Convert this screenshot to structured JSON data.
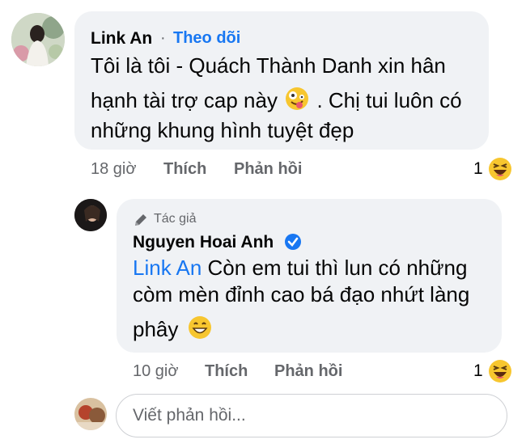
{
  "comment": {
    "author": "Link An",
    "separator": "·",
    "follow_label": "Theo dõi",
    "line1": "Tôi là tôi - Quách Thành Danh xin hân",
    "line2a": "hạnh tài trợ cap này",
    "line2b": ". Chị tui luôn có",
    "line3": "những khung hình tuyệt đẹp",
    "time": "18 giờ",
    "like_label": "Thích",
    "reply_label": "Phản hồi",
    "reaction_count": "1"
  },
  "reply": {
    "badge": "Tác giả",
    "author": "Nguyen Hoai Anh",
    "mention": "Link An",
    "line1": " Còn em tui thì lun có những",
    "line2": "còm mèn đỉnh cao bá đạo nhứt làng",
    "line3": "phây",
    "time": "10 giờ",
    "like_label": "Thích",
    "reply_label": "Phản hồi",
    "reaction_count": "1"
  },
  "composer": {
    "placeholder": "Viết phản hồi..."
  },
  "colors": {
    "bubble": "#f0f2f5",
    "link": "#1877f2",
    "meta": "#65676b",
    "verified": "#1877f2"
  }
}
